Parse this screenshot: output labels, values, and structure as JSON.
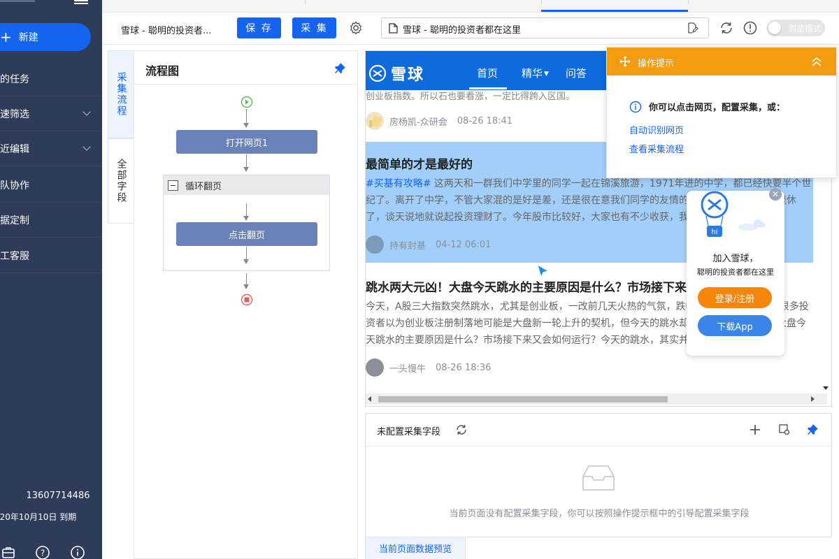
{
  "sidebar": {
    "new_label": "新建",
    "items": [
      {
        "label": "的任务",
        "expandable": false
      },
      {
        "label": "速筛选",
        "expandable": true
      },
      {
        "label": "近编辑",
        "expandable": true
      },
      {
        "label": "队协作",
        "expandable": false
      },
      {
        "label": "据定制",
        "expandable": false
      },
      {
        "label": "工客服",
        "expandable": false
      }
    ],
    "phone": "13607714486",
    "expire": "020年10月10日 到期",
    "icons": [
      "briefcase-icon",
      "help-icon",
      "info-icon"
    ]
  },
  "toolbar": {
    "task_title": "雪球 - 聪明的投资者...",
    "save_label": "保 存",
    "collect_label": "采 集",
    "url_text": "雪球 - 聪明的投资者都在这里",
    "browse_mode_label": "浏览模式",
    "browse_mode_on": false
  },
  "vtabs": [
    {
      "label": "采集流程",
      "active": true
    },
    {
      "label": "全部字段",
      "active": false
    }
  ],
  "flow": {
    "title": "流程图",
    "open_page": "打开网页1",
    "loop_label": "循环翻页",
    "click_page": "点击翻页"
  },
  "browser": {
    "logo_text": "雪球",
    "nav": [
      {
        "label": "首页",
        "active": true
      },
      {
        "label": "精华",
        "dropdown": true
      },
      {
        "label": "问答"
      }
    ],
    "top_fragment": "创业板指数。所以石也要看涨，一定比得跨入区国。",
    "posts": [
      {
        "author": "房杨凯-众研会",
        "date": "08-26 18:41"
      },
      {
        "title": "最简单的才是最好的",
        "tag": "#买基有攻略#",
        "body": " 这两天和一群我们中学里的同学一起在锦溪旅游，1971年进的中学，都已经快要半个世纪了。离开了中学，不管大家混的是好是差，还是很在意我们同学的友情的。到现在都已经全部退休了，谈天说地就说起投资理财了。今年股市比较好，大家也有不少收获，我...",
        "author": "持有封基",
        "date": "04-12 06:01",
        "highlighted": true
      },
      {
        "title": "跳水两大元凶！大盘今天跳水的主要原因是什么？市场接下来又会如何运行？",
        "body": "今天，A股三大指数突然跳水，尤其是创业板，一改前几天火热的气氛，跌幅超过了2%的跌幅。很多投资者以为创业板注册制落地可能是大盘新一轮上升的契机，但今天的跳水却是一个跳水的转折，大盘今天跳水的主要原因是什么？市场接下来又会如何运行？今天的跳水，其实并...",
        "author": "一头慢牛",
        "date": "08-26 18:36"
      }
    ],
    "popup": {
      "title": "加入雪球，",
      "subtitle": "聪明的投资者都在这里",
      "login_label": "登录/注册",
      "download_label": "下载App",
      "mascot_text": "hi"
    }
  },
  "tips": {
    "title": "操作提示",
    "info": "你可以点击网页，配置采集，或：",
    "links": [
      "自动识别网页",
      "查看采集流程"
    ]
  },
  "fields": {
    "title": "未配置采集字段",
    "empty_message": "当前页面没有配置采集字段，你可以按照操作提示框中的引导配置采集字段",
    "preview_tab": "当前页面数据预览"
  },
  "colors": {
    "sidebar_bg": "#2e3b59",
    "primary": "#1464f0",
    "flow_node": "#6a82b8",
    "xueqiu_blue": "#0d6bdb",
    "tips_orange": "#f39c12",
    "highlight": "#a2cffa",
    "popup_orange": "#f5860a",
    "popup_blue": "#3a86e8"
  }
}
